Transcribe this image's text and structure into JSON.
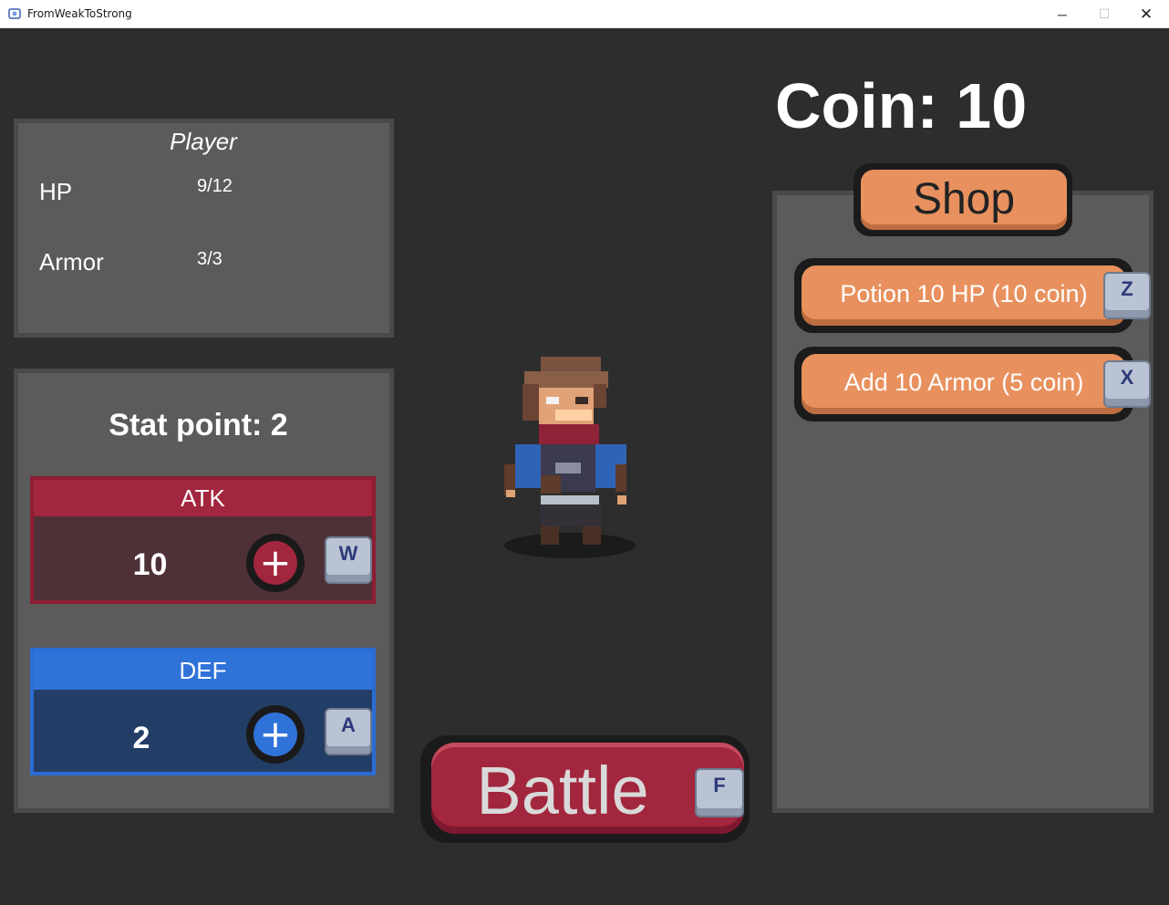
{
  "window": {
    "title": "FromWeakToStrong",
    "minimize": "─",
    "maximize": "☐",
    "close": "✕"
  },
  "player": {
    "title": "Player",
    "hp_label": "HP",
    "hp_value": "9/12",
    "armor_label": "Armor",
    "armor_value": "3/3"
  },
  "stats": {
    "stat_point_text": "Stat point: 2",
    "atk": {
      "label": "ATK",
      "value": "10",
      "plus": "+",
      "key": "W",
      "color": "#a2263d"
    },
    "def": {
      "label": "DEF",
      "value": "2",
      "plus": "+",
      "key": "A",
      "color": "#2f73d9"
    }
  },
  "coin": {
    "text": "Coin: 10"
  },
  "shop": {
    "title": "Shop",
    "items": [
      {
        "label": "Potion 10 HP (10 coin)",
        "key": "Z"
      },
      {
        "label": "Add 10 Armor (5 coin)",
        "key": "X"
      }
    ]
  },
  "battle": {
    "label": "Battle",
    "key": "F"
  },
  "colors": {
    "background": "#2d2d2d",
    "panel": "#5b5b5b",
    "orange_button": "#e8915e",
    "battle_red": "#a2263d"
  }
}
